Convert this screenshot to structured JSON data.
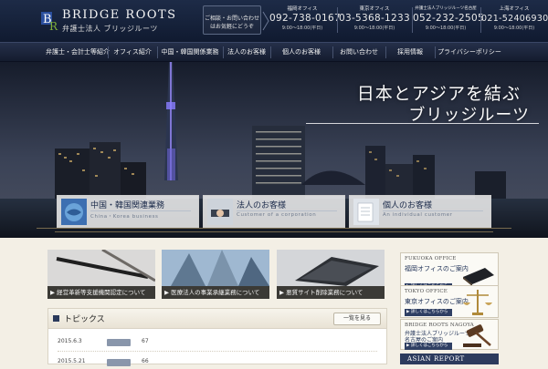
{
  "brand": {
    "name": "BRIDGE ROOTS",
    "sub": "弁護士法人 ブリッジルーツ"
  },
  "contact": {
    "line1": "ご相談・お問い合わせ",
    "line2": "はお気軽にどうぞ"
  },
  "offices": [
    {
      "name": "福岡オフィス",
      "phone": "092-738-0167",
      "hours": "9:00～18:00(平日)"
    },
    {
      "name": "東京オフィス",
      "phone": "03-5368-1233",
      "hours": "9:00～18:00(平日)"
    },
    {
      "name": "弁護士法人ブリッジルーツ名古屋",
      "phone": "052-232-2505",
      "hours": "9:00～18:00(平日)"
    },
    {
      "name": "上海オフィス",
      "phone": "021-52406930",
      "hours": "9:00～18:00(平日)"
    }
  ],
  "nav": [
    "弁護士・会計士等紹介",
    "オフィス紹介",
    "中国・韓国関係業務",
    "法人のお客様",
    "個人のお客様",
    "お問い合わせ",
    "採用情報",
    "プライバシーポリシー"
  ],
  "hero": {
    "title_line1": "日本とアジアを結ぶ",
    "title_line2": "ブリッジルーツ"
  },
  "services": [
    {
      "title": "中国・韓国関連業務",
      "sub": "China・Korea business"
    },
    {
      "title": "法人のお客様",
      "sub": "Customer of a corporation"
    },
    {
      "title": "個人のお客様",
      "sub": "An individual customer"
    }
  ],
  "thumbs": [
    "▶ 経営革新等支援機関認定について",
    "▶ 医療法人の事業承継業務について",
    "▶ 悪質サイト削除業務について"
  ],
  "topics": {
    "title": "トピックス",
    "more": "一覧を見る",
    "rows": [
      {
        "date": "2015.6.3",
        "text": "67"
      },
      {
        "date": "2015.5.21",
        "text": "66"
      }
    ]
  },
  "side_boxes": [
    {
      "en": "FUKUOKA OFFICE",
      "jp": [
        "福岡オフィスのご案内"
      ],
      "more": "▶ 詳しくはこちらから"
    },
    {
      "en": "TOKYO OFFICE",
      "jp": [
        "東京オフィスのご案内"
      ],
      "more": "▶ 詳しくはこちらから"
    },
    {
      "en": "BRIDGE ROOTS NAGOYA",
      "jp": [
        "弁護士法人ブリッジルーツ",
        "名古屋のご案内"
      ],
      "more": "▶ 詳しくはこちらから"
    }
  ],
  "asian_report": "ASIAN REPORT",
  "colors": {
    "header_bg": "#101a30",
    "accent_navy": "#2c3b5d",
    "page_bg": "#f3efe5"
  }
}
